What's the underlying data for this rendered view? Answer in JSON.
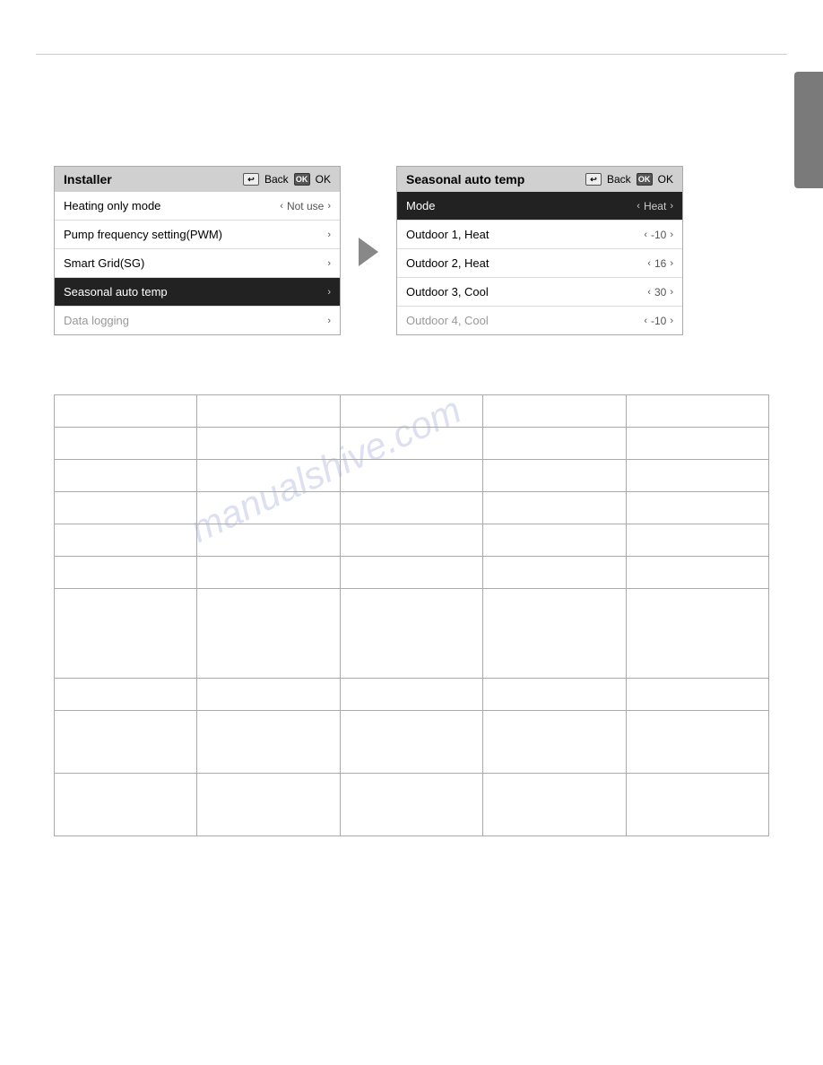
{
  "topLine": {},
  "rightBar": {},
  "panels": {
    "installer": {
      "title": "Installer",
      "backLabel": "Back",
      "okLabel": "OK",
      "rows": [
        {
          "label": "Heating only mode",
          "value": "Not use",
          "selected": false,
          "hasChevron": true
        },
        {
          "label": "Pump frequency setting(PWM)",
          "value": "",
          "selected": false,
          "hasChevron": true
        },
        {
          "label": "Smart Grid(SG)",
          "value": "",
          "selected": false,
          "hasChevron": true
        },
        {
          "label": "Seasonal auto temp",
          "value": "",
          "selected": true,
          "hasChevron": true
        },
        {
          "label": "Data logging",
          "value": "",
          "selected": false,
          "hasChevron": true
        }
      ]
    },
    "seasonal": {
      "title": "Seasonal auto temp",
      "backLabel": "Back",
      "okLabel": "OK",
      "rows": [
        {
          "label": "Mode",
          "value": "Heat",
          "selected": true,
          "hasChevron": true
        },
        {
          "label": "Outdoor 1, Heat",
          "value": "-10",
          "selected": false,
          "hasChevron": true
        },
        {
          "label": "Outdoor 2, Heat",
          "value": "16",
          "selected": false,
          "hasChevron": true
        },
        {
          "label": "Outdoor 3, Cool",
          "value": "30",
          "selected": false,
          "hasChevron": true
        },
        {
          "label": "Outdoor 4, Cool",
          "value": "-10",
          "selected": false,
          "hasChevron": true
        }
      ]
    }
  },
  "watermark": "manualshive.com",
  "table": {
    "cols": 5,
    "rows": 10
  }
}
